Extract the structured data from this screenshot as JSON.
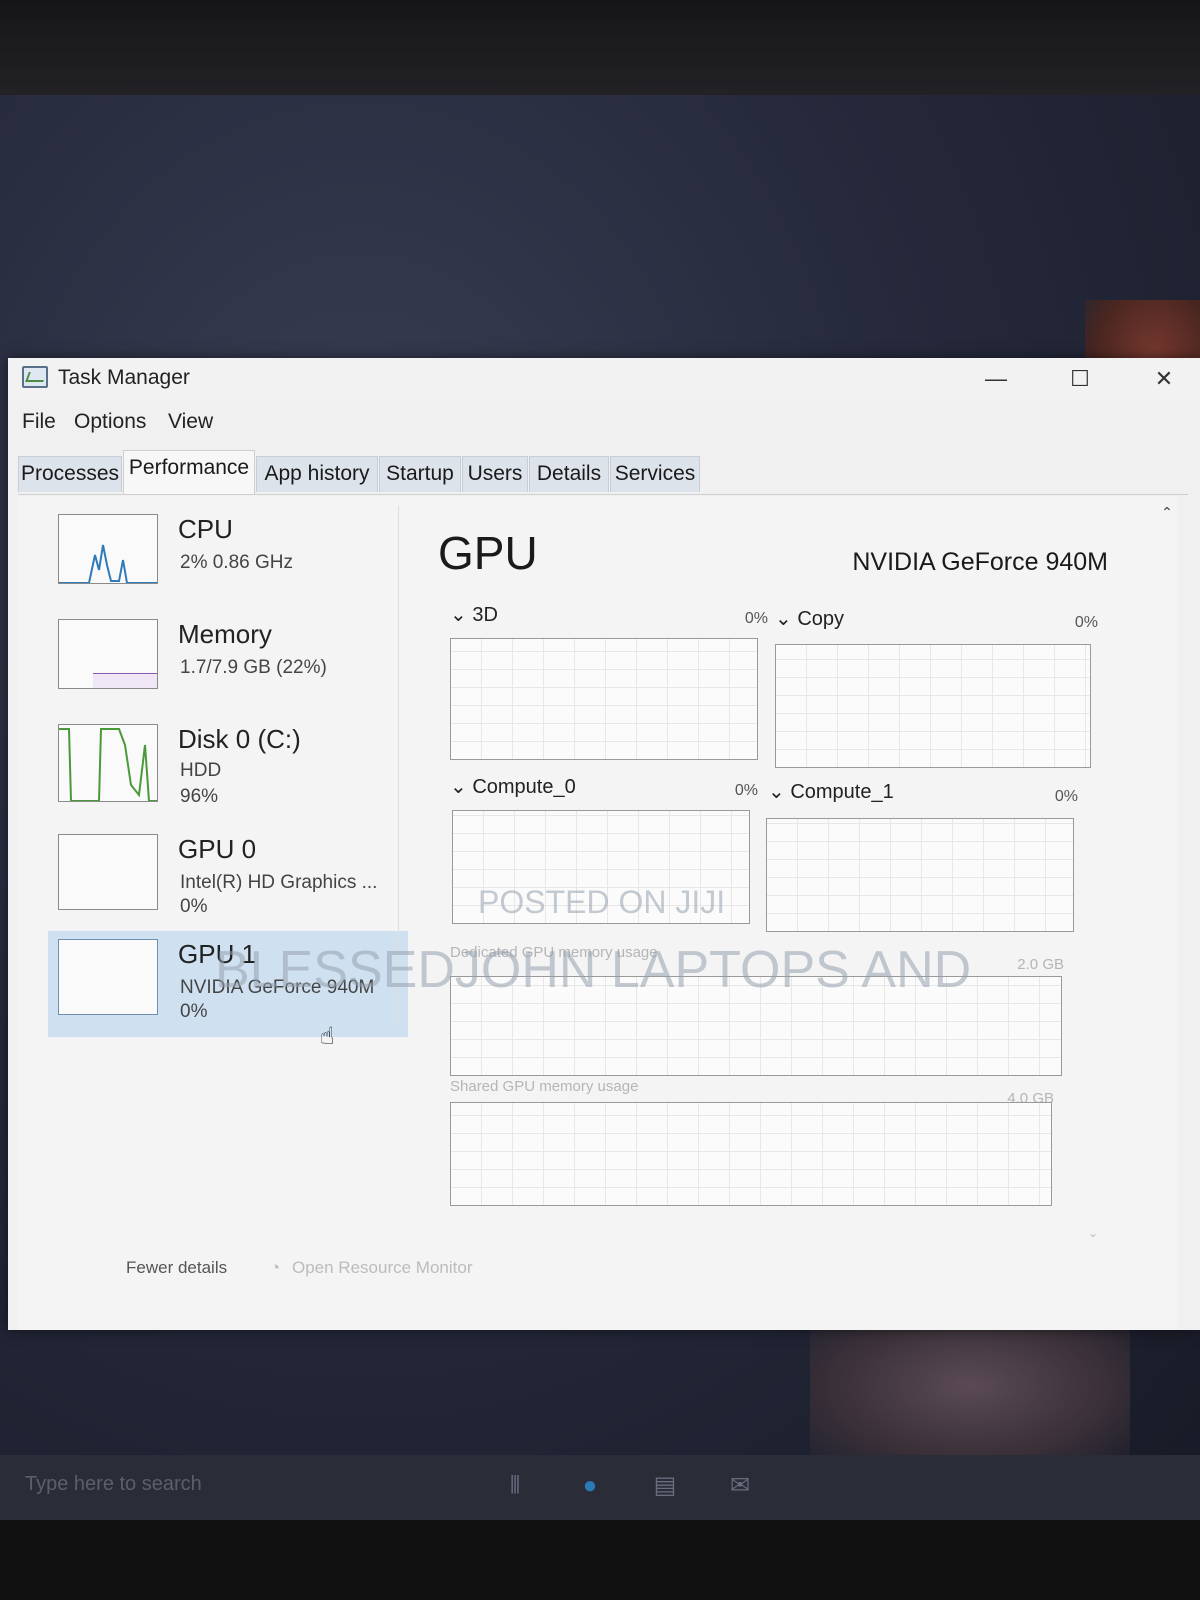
{
  "window": {
    "title": "Task Manager",
    "controls": {
      "minimize": "—",
      "maximize": "☐",
      "close": "✕"
    }
  },
  "menu": [
    "File",
    "Options",
    "View"
  ],
  "tabs": [
    {
      "label": "Processes",
      "active": false
    },
    {
      "label": "Performance",
      "active": true
    },
    {
      "label": "App history",
      "active": false
    },
    {
      "label": "Startup",
      "active": false
    },
    {
      "label": "Users",
      "active": false
    },
    {
      "label": "Details",
      "active": false
    },
    {
      "label": "Services",
      "active": false
    }
  ],
  "sidebar": {
    "items": [
      {
        "title": "CPU",
        "line1": "2%  0.86 GHz",
        "line2": ""
      },
      {
        "title": "Memory",
        "line1": "1.7/7.9 GB (22%)",
        "line2": ""
      },
      {
        "title": "Disk 0 (C:)",
        "line1": "HDD",
        "line2": "96%"
      },
      {
        "title": "GPU 0",
        "line1": "Intel(R) HD Graphics ...",
        "line2": "0%"
      },
      {
        "title": "GPU 1",
        "line1": "NVIDIA GeForce 940M",
        "line2": "0%"
      }
    ]
  },
  "main": {
    "title": "GPU",
    "device_name": "NVIDIA GeForce 940M",
    "engines": [
      {
        "label": "3D",
        "value": "0%"
      },
      {
        "label": "Copy",
        "value": "0%"
      },
      {
        "label": "Compute_0",
        "value": "0%"
      },
      {
        "label": "Compute_1",
        "value": "0%"
      }
    ],
    "dedicated": {
      "label": "Dedicated GPU memory usage",
      "max": "2.0 GB"
    },
    "shared": {
      "label": "Shared GPU memory usage",
      "max": "4.0 GB"
    }
  },
  "footer": {
    "fewer_details": "Fewer details",
    "open_resource_monitor": "Open Resource Monitor"
  },
  "taskbar": {
    "search_placeholder": "Type here to search"
  },
  "watermarks": [
    "POSTED ON JIJI",
    "BLESSEDJOHN LAPTOPS AND"
  ]
}
